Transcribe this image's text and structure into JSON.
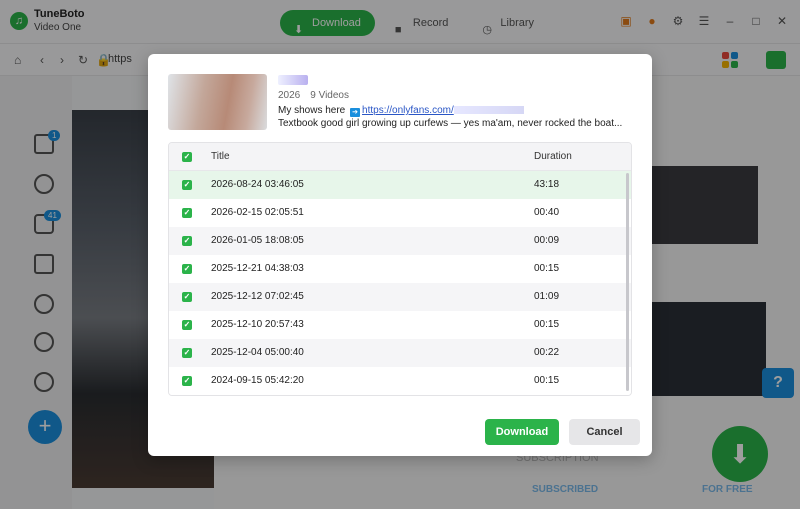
{
  "app": {
    "name": "TuneBoto",
    "subtitle": "Video One"
  },
  "top_tabs": [
    {
      "label": "Download",
      "icon": "download-icon",
      "active": true
    },
    {
      "label": "Record",
      "icon": "record-icon",
      "active": false
    },
    {
      "label": "Library",
      "icon": "library-icon",
      "active": false
    }
  ],
  "address": {
    "url_fragment": "https"
  },
  "sidebar": {
    "badges": {
      "home": "1",
      "messages": "41"
    }
  },
  "background": {
    "subscription_heading": "SUBSCRIPTION",
    "subscribed_label": "SUBSCRIBED",
    "for_free_label": "FOR FREE"
  },
  "colors": {
    "accent_green": "#2bb34a",
    "accent_blue": "#1a8fdd",
    "link_blue": "#2a56c6"
  },
  "modal": {
    "year": "2026",
    "video_count": "9 Videos",
    "desc_prefix": "My shows here",
    "desc_link": "https://onlyfans.com/",
    "desc_line2": "Textbook good girl growing up curfews — yes ma'am, never rocked the boat...",
    "columns": {
      "title": "Title",
      "duration": "Duration"
    },
    "rows": [
      {
        "title": "2026-08-24 03:46:05",
        "duration": "43:18"
      },
      {
        "title": "2026-02-15 02:05:51",
        "duration": "00:40"
      },
      {
        "title": "2026-01-05 18:08:05",
        "duration": "00:09"
      },
      {
        "title": "2025-12-21 04:38:03",
        "duration": "00:15"
      },
      {
        "title": "2025-12-12 07:02:45",
        "duration": "01:09"
      },
      {
        "title": "2025-12-10 20:57:43",
        "duration": "00:15"
      },
      {
        "title": "2025-12-04 05:00:40",
        "duration": "00:22"
      },
      {
        "title": "2024-09-15 05:42:20",
        "duration": "00:15"
      }
    ],
    "download_label": "Download",
    "cancel_label": "Cancel"
  }
}
